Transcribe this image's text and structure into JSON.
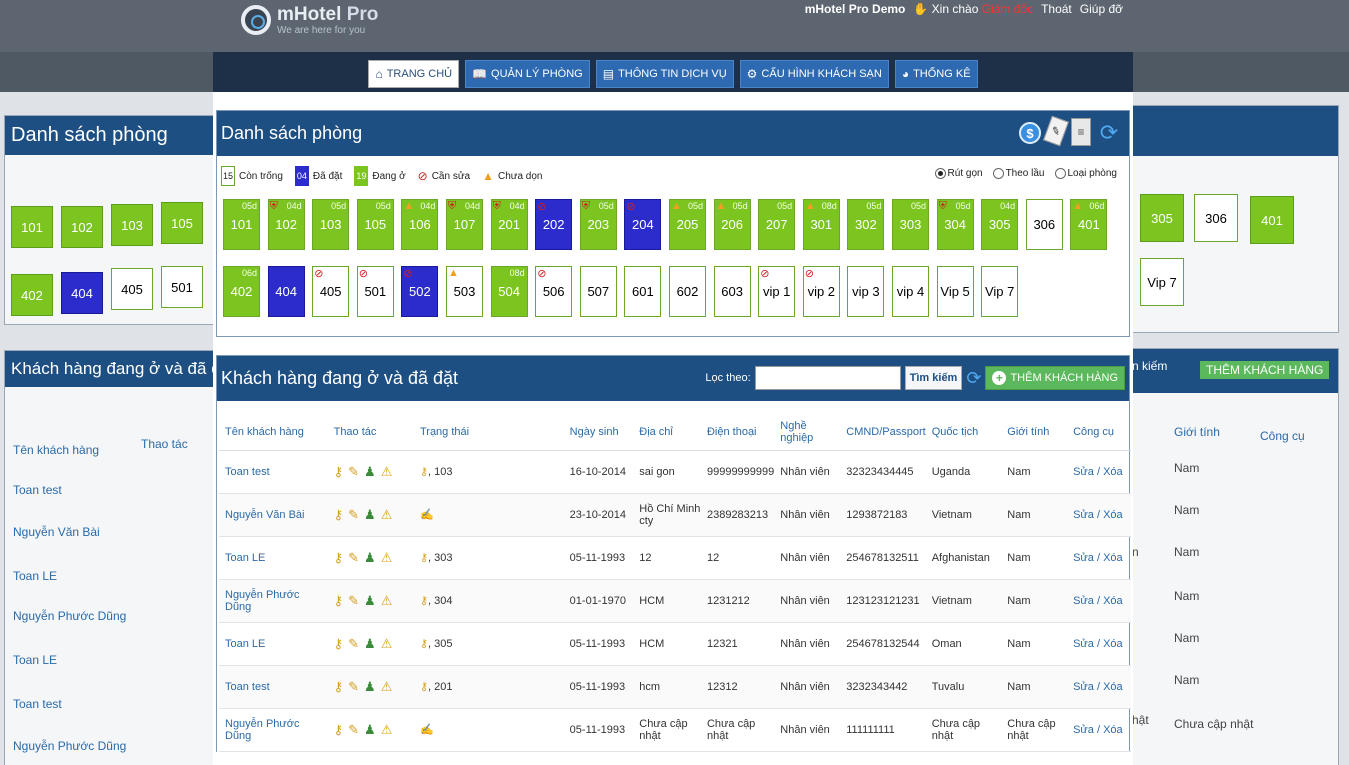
{
  "app": {
    "logo_title": "mHotel",
    "logo_pro": "Pro",
    "logo_sub": "We are here for you",
    "brand": "mHotel Pro Demo",
    "greeting": "Xin chào",
    "role": "Giám đốc",
    "logout": "Thoát",
    "help": "Giúp đỡ"
  },
  "nav": [
    {
      "label": "TRANG CHỦ",
      "icon": "home-icon"
    },
    {
      "label": "QUẢN LÝ PHÒNG",
      "icon": "book-icon"
    },
    {
      "label": "THÔNG TIN DỊCH VỤ",
      "icon": "service-icon"
    },
    {
      "label": "CẤU HÌNH KHÁCH SẠN",
      "icon": "gear-icon"
    },
    {
      "label": "THỐNG KÊ",
      "icon": "chart-icon"
    }
  ],
  "rooms_panel": {
    "title": "Danh sách phòng",
    "legend": {
      "free_count": "15",
      "free_label": "Còn trống",
      "booked_count": "04",
      "booked_label": "Đã đặt",
      "occ_count": "19",
      "occ_label": "Đang ở",
      "repair_label": "Cần sửa",
      "clean_label": "Chưa dọn"
    },
    "view_options": [
      "Rút gọn",
      "Theo lầu",
      "Loại phòng"
    ],
    "rooms_row1": [
      {
        "no": "101",
        "s": "occ",
        "d": "05d",
        "m": ""
      },
      {
        "no": "102",
        "s": "occ",
        "d": "04d",
        "m": "shield"
      },
      {
        "no": "103",
        "s": "occ",
        "d": "05d",
        "m": ""
      },
      {
        "no": "105",
        "s": "occ",
        "d": "05d",
        "m": ""
      },
      {
        "no": "106",
        "s": "occ",
        "d": "04d",
        "m": "warn"
      },
      {
        "no": "107",
        "s": "occ",
        "d": "04d",
        "m": "shield"
      },
      {
        "no": "201",
        "s": "occ",
        "d": "04d",
        "m": "shield"
      },
      {
        "no": "202",
        "s": "booked",
        "d": "",
        "m": "no"
      },
      {
        "no": "203",
        "s": "occ",
        "d": "05d",
        "m": "shield"
      },
      {
        "no": "204",
        "s": "booked",
        "d": "",
        "m": "no"
      },
      {
        "no": "205",
        "s": "occ",
        "d": "05d",
        "m": "warn"
      },
      {
        "no": "206",
        "s": "occ",
        "d": "05d",
        "m": "warn"
      },
      {
        "no": "207",
        "s": "occ",
        "d": "05d",
        "m": ""
      },
      {
        "no": "301",
        "s": "occ",
        "d": "08d",
        "m": "warn"
      },
      {
        "no": "302",
        "s": "occ",
        "d": "05d",
        "m": ""
      },
      {
        "no": "303",
        "s": "occ",
        "d": "05d",
        "m": ""
      },
      {
        "no": "304",
        "s": "occ",
        "d": "05d",
        "m": "shield"
      },
      {
        "no": "305",
        "s": "occ",
        "d": "04d",
        "m": ""
      },
      {
        "no": "306",
        "s": "free",
        "d": "",
        "m": ""
      },
      {
        "no": "401",
        "s": "occ",
        "d": "06d",
        "m": "warn"
      }
    ],
    "rooms_row2": [
      {
        "no": "402",
        "s": "occ",
        "d": "06d",
        "m": ""
      },
      {
        "no": "404",
        "s": "booked",
        "d": "",
        "m": ""
      },
      {
        "no": "405",
        "s": "free",
        "d": "",
        "m": "no"
      },
      {
        "no": "501",
        "s": "free",
        "d": "",
        "m": "no"
      },
      {
        "no": "502",
        "s": "booked",
        "d": "",
        "m": "no"
      },
      {
        "no": "503",
        "s": "free",
        "d": "",
        "m": "warn"
      },
      {
        "no": "504",
        "s": "occ",
        "d": "08d",
        "m": ""
      },
      {
        "no": "506",
        "s": "free",
        "d": "",
        "m": "no"
      },
      {
        "no": "507",
        "s": "free",
        "d": "",
        "m": ""
      },
      {
        "no": "601",
        "s": "free",
        "d": "",
        "m": ""
      },
      {
        "no": "602",
        "s": "free",
        "d": "",
        "m": ""
      },
      {
        "no": "603",
        "s": "free",
        "d": "",
        "m": ""
      },
      {
        "no": "vip 1",
        "s": "free",
        "d": "",
        "m": "no"
      },
      {
        "no": "vip 2",
        "s": "free",
        "d": "",
        "m": "no"
      },
      {
        "no": "vip 3",
        "s": "free",
        "d": "",
        "m": ""
      },
      {
        "no": "vip 4",
        "s": "free",
        "d": "",
        "m": ""
      },
      {
        "no": "Vip 5",
        "s": "free",
        "d": "",
        "m": ""
      },
      {
        "no": "Vip 7",
        "s": "free",
        "d": "",
        "m": ""
      }
    ]
  },
  "customers_panel": {
    "title": "Khách hàng đang ở và đã đặt",
    "filter_label": "Lọc theo:",
    "filter_value": "",
    "search_label": "Tìm kiếm",
    "add_label": "THÊM KHÁCH HÀNG",
    "columns": [
      "Tên khách hàng",
      "Thao tác",
      "Trạng thái",
      "Ngày sinh",
      "Địa chỉ",
      "Điện thoại",
      "Nghề nghiệp",
      "CMND/Passport",
      "Quốc tịch",
      "Giới tính",
      "Công cụ"
    ],
    "edit": "Sửa",
    "delete": "Xóa",
    "rows": [
      {
        "name": "Toan test",
        "status": ", 103",
        "dob": "16-10-2014",
        "addr": "sai gon",
        "phone": "99999999999",
        "job": "Nhân viên",
        "id": "32323434445",
        "nat": "Uganda",
        "sex": "Nam"
      },
      {
        "name": "Nguyễn Văn Bài",
        "status": "",
        "dob": "23-10-2014",
        "addr": "Hồ Chí Minh cty",
        "phone": "2389283213",
        "job": "Nhân viên",
        "id": "1293872183",
        "nat": "Vietnam",
        "sex": "Nam"
      },
      {
        "name": "Toan LE",
        "status": ", 303",
        "dob": "05-11-1993",
        "addr": "12",
        "phone": "12",
        "job": "Nhân viên",
        "id": "254678132511",
        "nat": "Afghanistan",
        "sex": "Nam"
      },
      {
        "name": "Nguyễn Phước Dũng",
        "status": ", 304",
        "dob": "01-01-1970",
        "addr": "HCM",
        "phone": "1231212",
        "job": "Nhân viên",
        "id": "123123121231",
        "nat": "Vietnam",
        "sex": "Nam"
      },
      {
        "name": "Toan LE",
        "status": ", 305",
        "dob": "05-11-1993",
        "addr": "HCM",
        "phone": "12321",
        "job": "Nhân viên",
        "id": "254678132544",
        "nat": "Oman",
        "sex": "Nam"
      },
      {
        "name": "Toan test",
        "status": ", 201",
        "dob": "05-11-1993",
        "addr": "hcm",
        "phone": "12312",
        "job": "Nhân viên",
        "id": "3232343442",
        "nat": "Tuvalu",
        "sex": "Nam"
      },
      {
        "name": "Nguyễn Phước Dũng",
        "status": "",
        "dob": "05-11-1993",
        "addr": "Chưa cập nhật",
        "phone": "Chưa cập nhật",
        "job": "Nhân viên",
        "id": "111111111",
        "nat": "Chưa cập nhật",
        "sex": "Chưa cập nhật"
      }
    ]
  },
  "ghost_left": {
    "title": "Danh sách phòng",
    "subtitle": "Khách hàng đang ở và đã đặt",
    "col1": "Tên khách hàng",
    "col2": "Thao tác",
    "names": [
      "Toan test",
      "Nguyễn Văn Bài",
      "Toan LE",
      "Nguyễn Phước Dũng",
      "Toan LE",
      "Toan test",
      "Nguyễn Phước Dũng"
    ]
  },
  "ghost_right": {
    "search_frag": "n kiếm",
    "add_label": "THÊM KHÁCH HÀNG",
    "col_sex": "Giới tính",
    "col_tools": "Công cụ",
    "sexes": [
      "Nam",
      "Nam",
      "Nam",
      "Nam",
      "Nam",
      "Nam",
      "Chưa cập nhật"
    ],
    "row6_frag": "hật",
    "row3_frag": "n"
  }
}
